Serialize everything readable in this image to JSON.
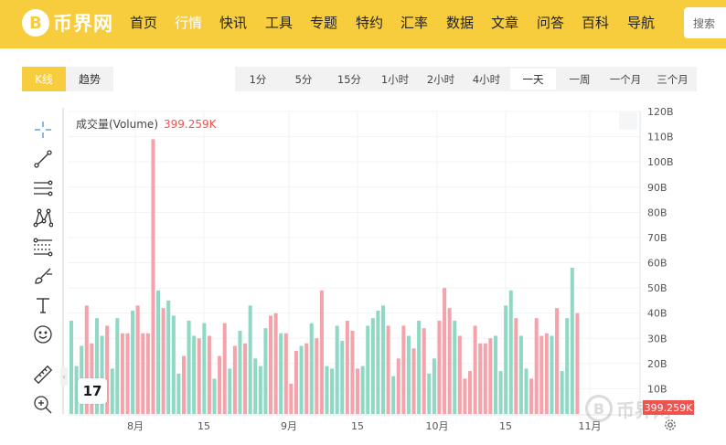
{
  "header": {
    "logo_glyph": "B",
    "logo_text": "币界网",
    "nav": [
      {
        "label": "首页",
        "active": false
      },
      {
        "label": "行情",
        "active": true
      },
      {
        "label": "快讯",
        "active": false
      },
      {
        "label": "工具",
        "active": false
      },
      {
        "label": "专题",
        "active": false
      },
      {
        "label": "特约",
        "active": false
      },
      {
        "label": "汇率",
        "active": false
      },
      {
        "label": "数据",
        "active": false
      },
      {
        "label": "文章",
        "active": false
      },
      {
        "label": "问答",
        "active": false
      },
      {
        "label": "百科",
        "active": false
      },
      {
        "label": "导航",
        "active": false
      }
    ],
    "search_label": "搜索"
  },
  "chart_tabs": [
    {
      "label": "K线",
      "active": true
    },
    {
      "label": "趋势",
      "active": false
    }
  ],
  "timeframes": [
    {
      "label": "1分",
      "active": false
    },
    {
      "label": "5分",
      "active": false
    },
    {
      "label": "15分",
      "active": false
    },
    {
      "label": "1小时",
      "active": false
    },
    {
      "label": "2小时",
      "active": false
    },
    {
      "label": "4小时",
      "active": false
    },
    {
      "label": "一天",
      "active": true
    },
    {
      "label": "一周",
      "active": false
    },
    {
      "label": "一个月",
      "active": false
    },
    {
      "label": "三个月",
      "active": false
    }
  ],
  "tools": [
    "crosshair-icon",
    "trend-line-icon",
    "parallel-lines-icon",
    "pattern-icon",
    "fib-levels-icon",
    "brush-icon",
    "text-icon",
    "emoji-icon",
    "ruler-icon",
    "zoom-in-icon"
  ],
  "tv_logo": "17",
  "watermark_text": "币界网",
  "colors": {
    "brand": "#f7cc3d",
    "up": "#8fd8c4",
    "down": "#f4a3aa",
    "price_badge": "#ef5350"
  },
  "chart_data": {
    "type": "bar",
    "legend_label": "成交量(Volume)",
    "legend_value": "399.259K",
    "last_value_label": "399.259K",
    "y_unit": "B",
    "ylim": [
      0,
      120
    ],
    "y_ticks": [
      "10B",
      "20B",
      "30B",
      "40B",
      "50B",
      "60B",
      "70B",
      "80B",
      "90B",
      "100B",
      "110B",
      "120B"
    ],
    "x_ticks": [
      "8月",
      "15",
      "9月",
      "15",
      "10月",
      "15",
      "11月"
    ],
    "grid": true,
    "series": [
      {
        "values": [
          37,
          19,
          27,
          43,
          28,
          38,
          31,
          35,
          18,
          38,
          32,
          32,
          41,
          43,
          32,
          32,
          109,
          49,
          42,
          45,
          39,
          16,
          23,
          37,
          31,
          30,
          36,
          31,
          14,
          23,
          36,
          18,
          27,
          33,
          28,
          43,
          22,
          19,
          34,
          39,
          40,
          32,
          32,
          12,
          25,
          27,
          28,
          36,
          30,
          49,
          19,
          18,
          35,
          29,
          37,
          33,
          18,
          19,
          35,
          38,
          41,
          43,
          35,
          15,
          22,
          35,
          31,
          26,
          37,
          34,
          16,
          22,
          37,
          50,
          42,
          37,
          31,
          14,
          17,
          35,
          28,
          28,
          30,
          31,
          17,
          43,
          49,
          38,
          31,
          18,
          14,
          38,
          31,
          32,
          31,
          42,
          17,
          38,
          58,
          40
        ]
      },
      {
        "directions": [
          "u",
          "u",
          "u",
          "d",
          "d",
          "u",
          "u",
          "d",
          "u",
          "u",
          "d",
          "d",
          "u",
          "d",
          "d",
          "d",
          "d",
          "u",
          "d",
          "u",
          "u",
          "u",
          "d",
          "u",
          "u",
          "d",
          "u",
          "d",
          "u",
          "d",
          "d",
          "u",
          "d",
          "u",
          "d",
          "u",
          "u",
          "u",
          "u",
          "d",
          "d",
          "u",
          "d",
          "d",
          "d",
          "u",
          "d",
          "u",
          "d",
          "d",
          "u",
          "u",
          "u",
          "u",
          "d",
          "d",
          "d",
          "u",
          "u",
          "u",
          "u",
          "u",
          "d",
          "u",
          "d",
          "d",
          "u",
          "d",
          "u",
          "d",
          "u",
          "u",
          "d",
          "d",
          "d",
          "u",
          "d",
          "d",
          "d",
          "d",
          "d",
          "d",
          "d",
          "u",
          "u",
          "u",
          "u",
          "d",
          "u",
          "u",
          "d",
          "d",
          "d",
          "d",
          "u",
          "d",
          "u",
          "u",
          "u",
          "d"
        ]
      }
    ]
  }
}
